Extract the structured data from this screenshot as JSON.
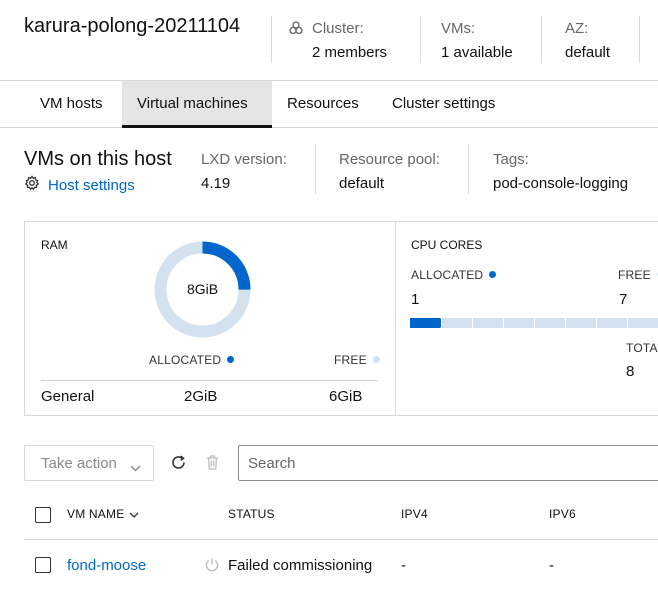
{
  "header": {
    "host_name": "karura-polong-20211104",
    "cluster_label": "Cluster:",
    "cluster_value": "2 members",
    "vms_label": "VMs:",
    "vms_value": "1 available",
    "az_label": "AZ:",
    "az_value": "default"
  },
  "tabs": [
    {
      "label": "VM hosts",
      "active": false
    },
    {
      "label": "Virtual machines",
      "active": true
    },
    {
      "label": "Resources",
      "active": false
    },
    {
      "label": "Cluster settings",
      "active": false
    }
  ],
  "summary": {
    "title": "VMs on this host",
    "host_settings_link": "Host settings",
    "lxd_version_label": "LXD version:",
    "lxd_version_value": "4.19",
    "resource_pool_label": "Resource pool:",
    "resource_pool_value": "default",
    "tags_label": "Tags:",
    "tags_value": "pod-console-logging"
  },
  "ram": {
    "title": "RAM",
    "total": "8GiB",
    "allocated_label": "ALLOCATED",
    "free_label": "FREE",
    "allocated_fraction": 0.25,
    "row_label": "General",
    "row_allocated": "2GiB",
    "row_free": "6GiB"
  },
  "cpu": {
    "title": "CPU CORES",
    "allocated_label": "ALLOCATED",
    "allocated_value": "1",
    "free_label": "FREE",
    "free_value": "7",
    "total_label": "TOTAL",
    "total_value": "8",
    "allocated_count": 1,
    "total_count": 8
  },
  "toolbar": {
    "take_action_label": "Take action",
    "search_placeholder": "Search"
  },
  "table": {
    "columns": [
      "VM NAME",
      "STATUS",
      "IPV4",
      "IPV6"
    ],
    "rows": [
      {
        "name": "fond-moose",
        "status": "Failed commissioning",
        "ipv4": "-",
        "ipv6": "-"
      }
    ]
  },
  "colors": {
    "accent": "#0066cc",
    "free": "#d3e2ee",
    "link": "#0066cc"
  },
  "icons": [
    "cluster-icon",
    "gear-icon",
    "chevron-down-icon",
    "refresh-icon",
    "trash-icon",
    "power-icon",
    "sort-chevron-icon"
  ]
}
